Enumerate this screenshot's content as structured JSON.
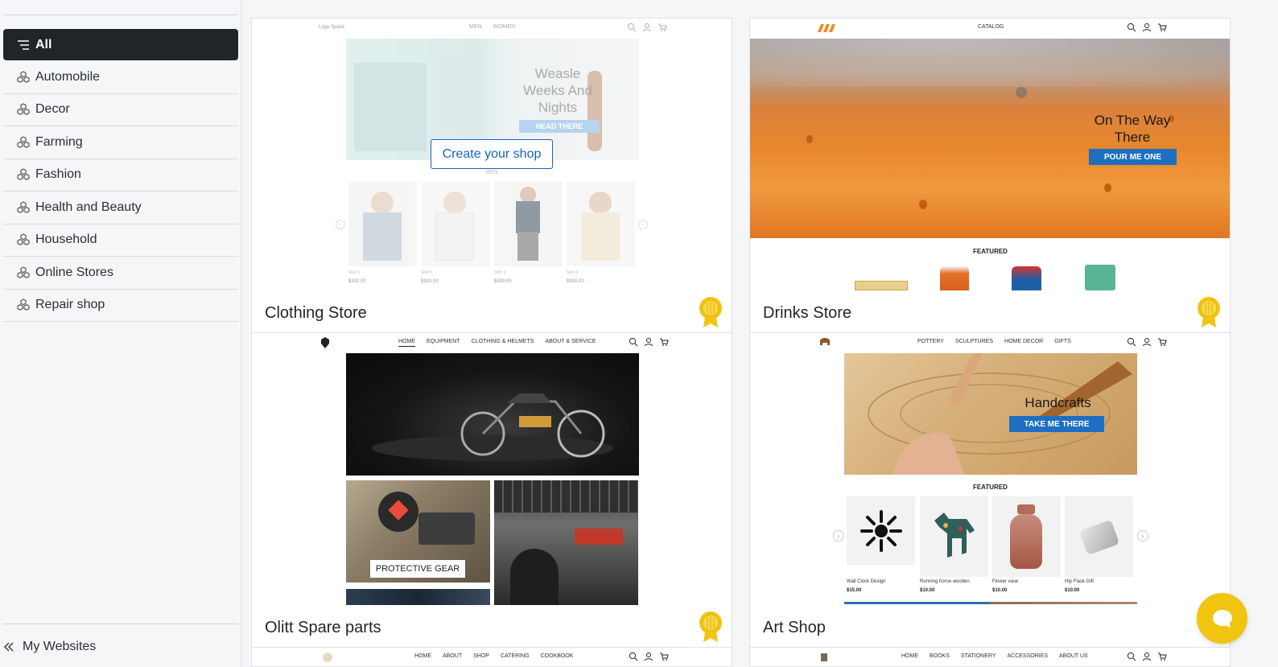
{
  "sidebar": {
    "categories": [
      {
        "label": "All",
        "active": true
      },
      {
        "label": "Automobile"
      },
      {
        "label": "Decor"
      },
      {
        "label": "Farming"
      },
      {
        "label": "Fashion"
      },
      {
        "label": "Health and Beauty"
      },
      {
        "label": "Household"
      },
      {
        "label": "Online Stores"
      },
      {
        "label": "Repair shop"
      }
    ],
    "footer_label": "My Websites"
  },
  "cards": [
    {
      "title": "Clothing Store",
      "premium": true,
      "create_label": "Create your shop",
      "preview": {
        "logo": "Logo Space",
        "nav": [
          "MEN",
          "WOMEN"
        ],
        "hero_text": "Weasle Weeks And Nights",
        "hero_button": "HEAD THERE",
        "section": "MEN",
        "products": [
          {
            "name": "Shirt 1",
            "price": "$300.00"
          },
          {
            "name": "Shirt 2",
            "price": "$300.00"
          },
          {
            "name": "Shirt 3",
            "price": "$300.00"
          },
          {
            "name": "Shirt 4",
            "price": "$300.00"
          }
        ]
      }
    },
    {
      "title": "Drinks Store",
      "premium": true,
      "preview": {
        "nav": [
          "CATALOG"
        ],
        "hero_text": "On The Way There",
        "hero_button": "POUR ME ONE",
        "section": "FEATURED"
      }
    },
    {
      "title": "Olitt Spare parts",
      "premium": true,
      "preview": {
        "nav": [
          "HOME",
          "EQUIPMENT",
          "CLOTHING & HELMETS",
          "ABOUT & SERVICE"
        ],
        "tile_label": "PROTECTIVE GEAR"
      }
    },
    {
      "title": "Art Shop",
      "premium": false,
      "preview": {
        "nav": [
          "POTTERY",
          "SCULPTURES",
          "HOME DECOR",
          "GIFTS"
        ],
        "hero_text": "Handcrafts",
        "hero_button": "TAKE ME THERE",
        "section": "FEATURED",
        "products": [
          {
            "name": "Wall Clock Design",
            "price": "$15.00"
          },
          {
            "name": "Running horse wooden",
            "price": "$10.00"
          },
          {
            "name": "Flower vase",
            "price": "$10.00"
          },
          {
            "name": "Hip Flask Gift",
            "price": "$10.00"
          }
        ]
      }
    },
    {
      "preview": {
        "nav": [
          "HOME",
          "ABOUT",
          "SHOP",
          "CATERING",
          "COOKBOOK"
        ]
      }
    },
    {
      "preview": {
        "nav": [
          "HOME",
          "BOOKS",
          "STATIONERY",
          "ACCESSORIES",
          "ABOUT US"
        ]
      }
    }
  ],
  "colors": {
    "active_category_bg": "#212529",
    "create_button": "#1565c0",
    "badge_gold": "#f1c40f",
    "chat_button": "#f1c40f",
    "drinks_button": "#1e6fc2"
  },
  "icons": {
    "category": "cubes-icon",
    "all": "list-icon",
    "footer": "double-chevron-left-icon",
    "chat": "chat-bubble-icon"
  }
}
